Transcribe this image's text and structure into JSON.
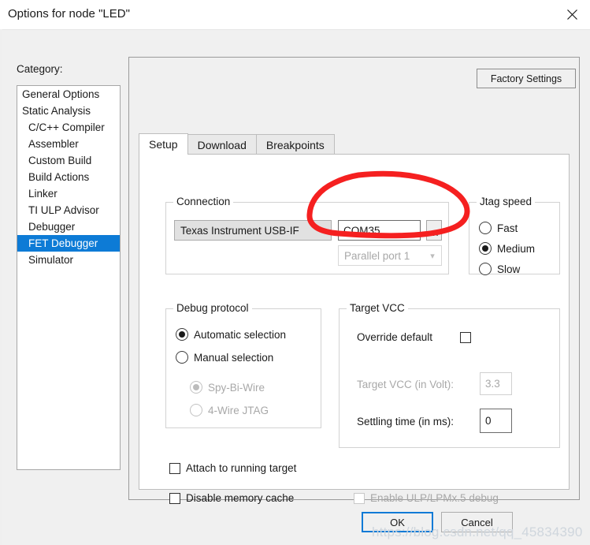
{
  "window": {
    "title": "Options for node \"LED\"",
    "close_icon": "close-icon"
  },
  "category": {
    "label": "Category:",
    "items": [
      {
        "label": "General Options",
        "indent": false,
        "selected": false
      },
      {
        "label": "Static Analysis",
        "indent": false,
        "selected": false
      },
      {
        "label": "C/C++ Compiler",
        "indent": true,
        "selected": false
      },
      {
        "label": "Assembler",
        "indent": true,
        "selected": false
      },
      {
        "label": "Custom Build",
        "indent": true,
        "selected": false
      },
      {
        "label": "Build Actions",
        "indent": true,
        "selected": false
      },
      {
        "label": "Linker",
        "indent": true,
        "selected": false
      },
      {
        "label": "TI ULP Advisor",
        "indent": true,
        "selected": false
      },
      {
        "label": "Debugger",
        "indent": true,
        "selected": false
      },
      {
        "label": "FET Debugger",
        "indent": true,
        "selected": true
      },
      {
        "label": "Simulator",
        "indent": true,
        "selected": false
      }
    ],
    "selected_color": "#0d7bd6"
  },
  "panel": {
    "factory_settings_label": "Factory Settings"
  },
  "tabs": [
    {
      "label": "Setup",
      "active": true
    },
    {
      "label": "Download",
      "active": false
    },
    {
      "label": "Breakpoints",
      "active": false
    }
  ],
  "connection": {
    "title": "Connection",
    "device_combo_value": "Texas Instrument USB-IF",
    "port_textbox_value": "COM35",
    "browse_button_label": "...",
    "parallel_combo_value": "Parallel port 1",
    "parallel_combo_enabled": false
  },
  "jtag_speed": {
    "title": "Jtag speed",
    "options": [
      {
        "label": "Fast",
        "checked": false
      },
      {
        "label": "Medium",
        "checked": true
      },
      {
        "label": "Slow",
        "checked": false
      }
    ]
  },
  "debug_protocol": {
    "title": "Debug protocol",
    "options": [
      {
        "label": "Automatic selection",
        "checked": true,
        "enabled": true
      },
      {
        "label": "Manual selection",
        "checked": false,
        "enabled": true
      },
      {
        "label": "Spy-Bi-Wire",
        "checked": true,
        "enabled": false
      },
      {
        "label": "4-Wire JTAG",
        "checked": false,
        "enabled": false
      }
    ]
  },
  "target_vcc": {
    "title": "Target VCC",
    "override_default_label": "Override default",
    "override_default_checked": false,
    "vcc_label": "Target VCC (in Volt):",
    "vcc_value": "3.3",
    "vcc_enabled": false,
    "settling_label": "Settling time (in ms):",
    "settling_value": "0",
    "settling_enabled": true
  },
  "bottom_options": [
    {
      "label": "Attach to running target",
      "checked": false,
      "enabled": true
    },
    {
      "label": "Disable memory cache",
      "checked": false,
      "enabled": true
    },
    {
      "label": "Enable ULP/LPMx.5 debug",
      "checked": false,
      "enabled": false
    }
  ],
  "dialog_buttons": {
    "ok_label": "OK",
    "cancel_label": "Cancel",
    "default_accent": "#0f7ad6"
  },
  "annotation": {
    "type": "hand-drawn-ellipse",
    "color": "#f52020",
    "target": "COM35 port field"
  },
  "watermark": {
    "text": "https://blog.csdn.net/qq_45834390"
  }
}
